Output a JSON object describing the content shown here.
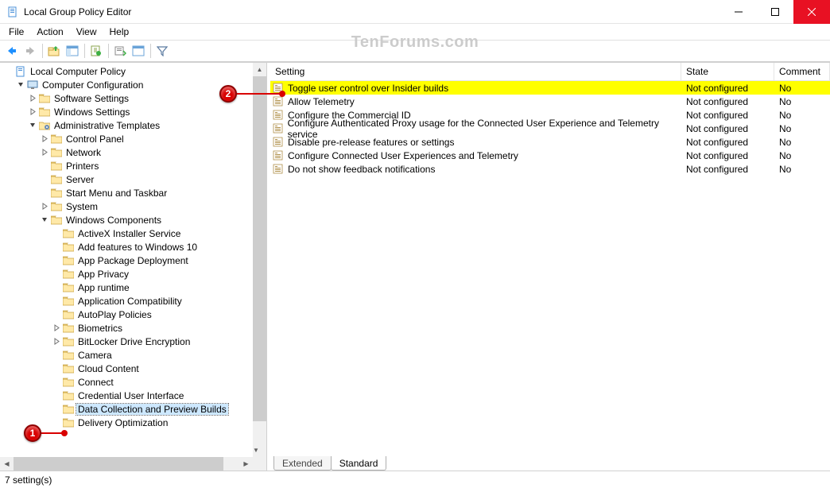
{
  "window": {
    "title": "Local Group Policy Editor"
  },
  "menu": {
    "file": "File",
    "action": "Action",
    "view": "View",
    "help": "Help"
  },
  "watermark": "TenForums.com",
  "tree": {
    "root": "Local Computer Policy",
    "items": [
      {
        "label": "Computer Configuration",
        "indent": 1,
        "exp": "v",
        "type": "comp"
      },
      {
        "label": "Software Settings",
        "indent": 2,
        "exp": ">",
        "type": "folder"
      },
      {
        "label": "Windows Settings",
        "indent": 2,
        "exp": ">",
        "type": "folder"
      },
      {
        "label": "Administrative Templates",
        "indent": 2,
        "exp": "v",
        "type": "templates"
      },
      {
        "label": "Control Panel",
        "indent": 3,
        "exp": ">",
        "type": "folder"
      },
      {
        "label": "Network",
        "indent": 3,
        "exp": ">",
        "type": "folder"
      },
      {
        "label": "Printers",
        "indent": 3,
        "exp": "",
        "type": "folder"
      },
      {
        "label": "Server",
        "indent": 3,
        "exp": "",
        "type": "folder"
      },
      {
        "label": "Start Menu and Taskbar",
        "indent": 3,
        "exp": "",
        "type": "folder"
      },
      {
        "label": "System",
        "indent": 3,
        "exp": ">",
        "type": "folder"
      },
      {
        "label": "Windows Components",
        "indent": 3,
        "exp": "v",
        "type": "folder"
      },
      {
        "label": "ActiveX Installer Service",
        "indent": 4,
        "exp": "",
        "type": "folder"
      },
      {
        "label": "Add features to Windows 10",
        "indent": 4,
        "exp": "",
        "type": "folder"
      },
      {
        "label": "App Package Deployment",
        "indent": 4,
        "exp": "",
        "type": "folder"
      },
      {
        "label": "App Privacy",
        "indent": 4,
        "exp": "",
        "type": "folder"
      },
      {
        "label": "App runtime",
        "indent": 4,
        "exp": "",
        "type": "folder"
      },
      {
        "label": "Application Compatibility",
        "indent": 4,
        "exp": "",
        "type": "folder"
      },
      {
        "label": "AutoPlay Policies",
        "indent": 4,
        "exp": "",
        "type": "folder"
      },
      {
        "label": "Biometrics",
        "indent": 4,
        "exp": ">",
        "type": "folder"
      },
      {
        "label": "BitLocker Drive Encryption",
        "indent": 4,
        "exp": ">",
        "type": "folder"
      },
      {
        "label": "Camera",
        "indent": 4,
        "exp": "",
        "type": "folder"
      },
      {
        "label": "Cloud Content",
        "indent": 4,
        "exp": "",
        "type": "folder"
      },
      {
        "label": "Connect",
        "indent": 4,
        "exp": "",
        "type": "folder"
      },
      {
        "label": "Credential User Interface",
        "indent": 4,
        "exp": "",
        "type": "folder"
      },
      {
        "label": "Data Collection and Preview Builds",
        "indent": 4,
        "exp": "",
        "type": "folder",
        "selected": true
      },
      {
        "label": "Delivery Optimization",
        "indent": 4,
        "exp": "",
        "type": "folder"
      }
    ]
  },
  "list": {
    "header": {
      "setting": "Setting",
      "state": "State",
      "comment": "Comment"
    },
    "rows": [
      {
        "name": "Toggle user control over Insider builds",
        "state": "Not configured",
        "comment": "No",
        "hl": true
      },
      {
        "name": "Allow Telemetry",
        "state": "Not configured",
        "comment": "No"
      },
      {
        "name": "Configure the Commercial ID",
        "state": "Not configured",
        "comment": "No"
      },
      {
        "name": "Configure Authenticated Proxy usage for the Connected User Experience and Telemetry service",
        "state": "Not configured",
        "comment": "No"
      },
      {
        "name": "Disable pre-release features or settings",
        "state": "Not configured",
        "comment": "No"
      },
      {
        "name": "Configure Connected User Experiences and Telemetry",
        "state": "Not configured",
        "comment": "No"
      },
      {
        "name": "Do not show feedback notifications",
        "state": "Not configured",
        "comment": "No"
      }
    ]
  },
  "tabs": {
    "extended": "Extended",
    "standard": "Standard"
  },
  "status": "7 setting(s)",
  "callouts": {
    "one": "1",
    "two": "2"
  }
}
